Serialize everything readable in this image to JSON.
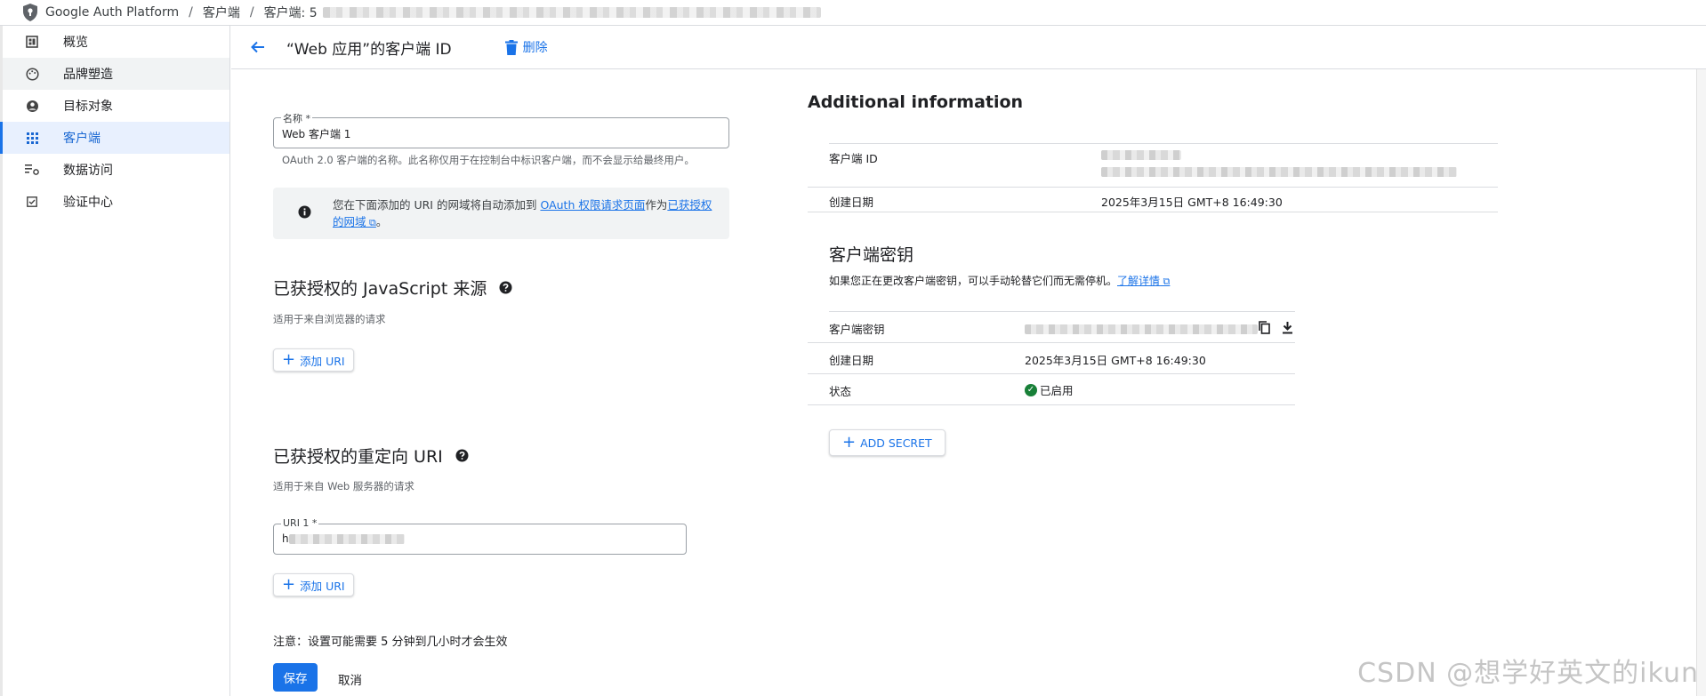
{
  "breadcrumb": {
    "product": "Google Auth Platform",
    "items": [
      "客户端",
      "客户端: 5"
    ]
  },
  "sidebar": {
    "items": [
      {
        "label": "概览",
        "icon": "dashboard-icon"
      },
      {
        "label": "品牌塑造",
        "icon": "palette-icon"
      },
      {
        "label": "目标对象",
        "icon": "account-circle-icon"
      },
      {
        "label": "客户端",
        "icon": "grid-icon"
      },
      {
        "label": "数据访问",
        "icon": "data-settings-icon"
      },
      {
        "label": "验证中心",
        "icon": "check-box-icon"
      }
    ],
    "active_index": 3,
    "hover_index": 1
  },
  "header": {
    "title": "“Web 应用”的客户端 ID",
    "delete_label": "删除"
  },
  "form": {
    "name_label": "名称 *",
    "name_value": "Web 客户端 1",
    "name_helper": "OAuth 2.0 客户端的名称。此名称仅用于在控制台中标识客户端，而不会显示给最终用户。",
    "info_text_1": "您在下面添加的 URI 的网域将自动添加到 ",
    "info_link_1": "OAuth 权限请求页面",
    "info_text_2": "作为",
    "info_link_2": "已获授权的网域",
    "info_text_3": "。",
    "js_origins_title": "已获授权的 JavaScript 来源",
    "js_origins_helper": "适用于来自浏览器的请求",
    "add_uri_label": "添加 URI",
    "redirect_title": "已获授权的重定向 URI",
    "redirect_helper": "适用于来自 Web 服务器的请求",
    "uri1_label": "URI 1 *",
    "uri1_value_prefix": "h",
    "note": "注意：设置可能需要 5 分钟到几小时才会生效",
    "save_label": "保存",
    "cancel_label": "取消"
  },
  "additional": {
    "title": "Additional information",
    "client_id_label": "客户端 ID",
    "created_label": "创建日期",
    "created_value": "2025年3月15日 GMT+8 16:49:30"
  },
  "secrets": {
    "title": "客户端密钥",
    "desc": "如果您正在更改客户端密钥，可以手动轮替它们而无需停机。",
    "learn_more": "了解详情",
    "secret_label": "客户端密钥",
    "created_label": "创建日期",
    "created_value": "2025年3月15日 GMT+8 16:49:30",
    "status_label": "状态",
    "status_value": "已启用",
    "add_secret_label": "ADD SECRET"
  },
  "colors": {
    "accent": "#1a73e8",
    "active_bg": "#e8f0fe",
    "success": "#188038"
  },
  "watermark": "CSDN @想学好英文的ikun"
}
